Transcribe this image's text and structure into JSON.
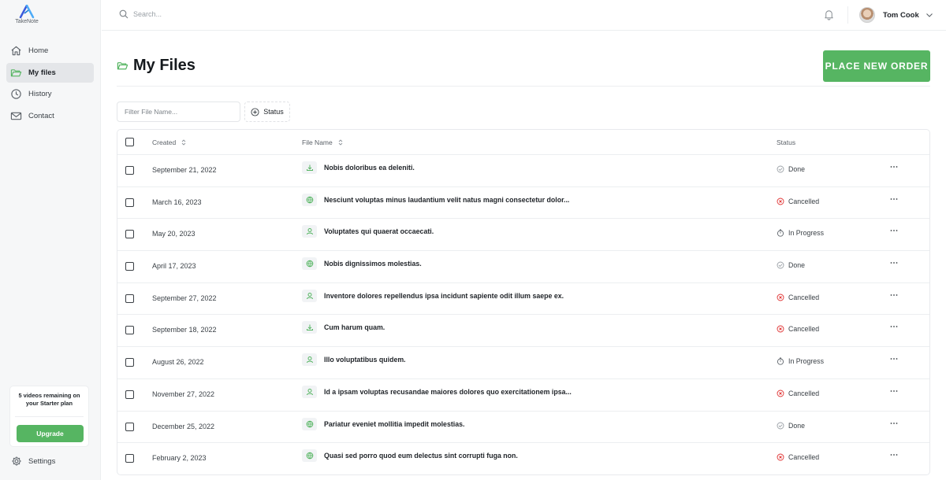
{
  "app": {
    "name": "TakeNote",
    "accent": "#56b562"
  },
  "sidebar": {
    "items": [
      {
        "label": "Home",
        "icon": "home-icon"
      },
      {
        "label": "My files",
        "icon": "folder-open-icon",
        "active": true
      },
      {
        "label": "History",
        "icon": "clock-icon"
      },
      {
        "label": "Contact",
        "icon": "mail-icon"
      }
    ],
    "plan_text": "5 videos remaining on your Starter plan",
    "upgrade_label": "Upgrade",
    "settings_label": "Settings"
  },
  "topbar": {
    "search_placeholder": "Search...",
    "user_name": "Tom Cook"
  },
  "header": {
    "title": "My Files",
    "order_button": "PLACE NEW ORDER"
  },
  "filters": {
    "filter_placeholder": "Filter File Name...",
    "status_label": "Status"
  },
  "table": {
    "columns": [
      "Created",
      "File Name",
      "Status"
    ],
    "rows": [
      {
        "created": "September 21, 2022",
        "file": "Nobis doloribus ea deleniti.",
        "icon": "download-icon",
        "status": "Done"
      },
      {
        "created": "March 16, 2023",
        "file": "Nesciunt voluptas minus laudantium velit natus magni consectetur dolor...",
        "icon": "globe-icon",
        "status": "Cancelled"
      },
      {
        "created": "May 20, 2023",
        "file": "Voluptates qui quaerat occaecati.",
        "icon": "user-icon",
        "status": "In Progress"
      },
      {
        "created": "April 17, 2023",
        "file": "Nobis dignissimos molestias.",
        "icon": "globe-icon",
        "status": "Done"
      },
      {
        "created": "September 27, 2022",
        "file": "Inventore dolores repellendus ipsa incidunt sapiente odit illum saepe ex.",
        "icon": "user-icon",
        "status": "Cancelled"
      },
      {
        "created": "September 18, 2022",
        "file": "Cum harum quam.",
        "icon": "download-icon",
        "status": "Cancelled"
      },
      {
        "created": "August 26, 2022",
        "file": "Illo voluptatibus quidem.",
        "icon": "user-icon",
        "status": "In Progress"
      },
      {
        "created": "November 27, 2022",
        "file": "Id a ipsam voluptas recusandae maiores dolores quo exercitationem ipsa...",
        "icon": "user-icon",
        "status": "Cancelled"
      },
      {
        "created": "December 25, 2022",
        "file": "Pariatur eveniet mollitia impedit molestias.",
        "icon": "globe-icon",
        "status": "Done"
      },
      {
        "created": "February 2, 2023",
        "file": "Quasi sed porro quod eum delectus sint corrupti fuga non.",
        "icon": "globe-icon",
        "status": "Cancelled"
      }
    ]
  }
}
